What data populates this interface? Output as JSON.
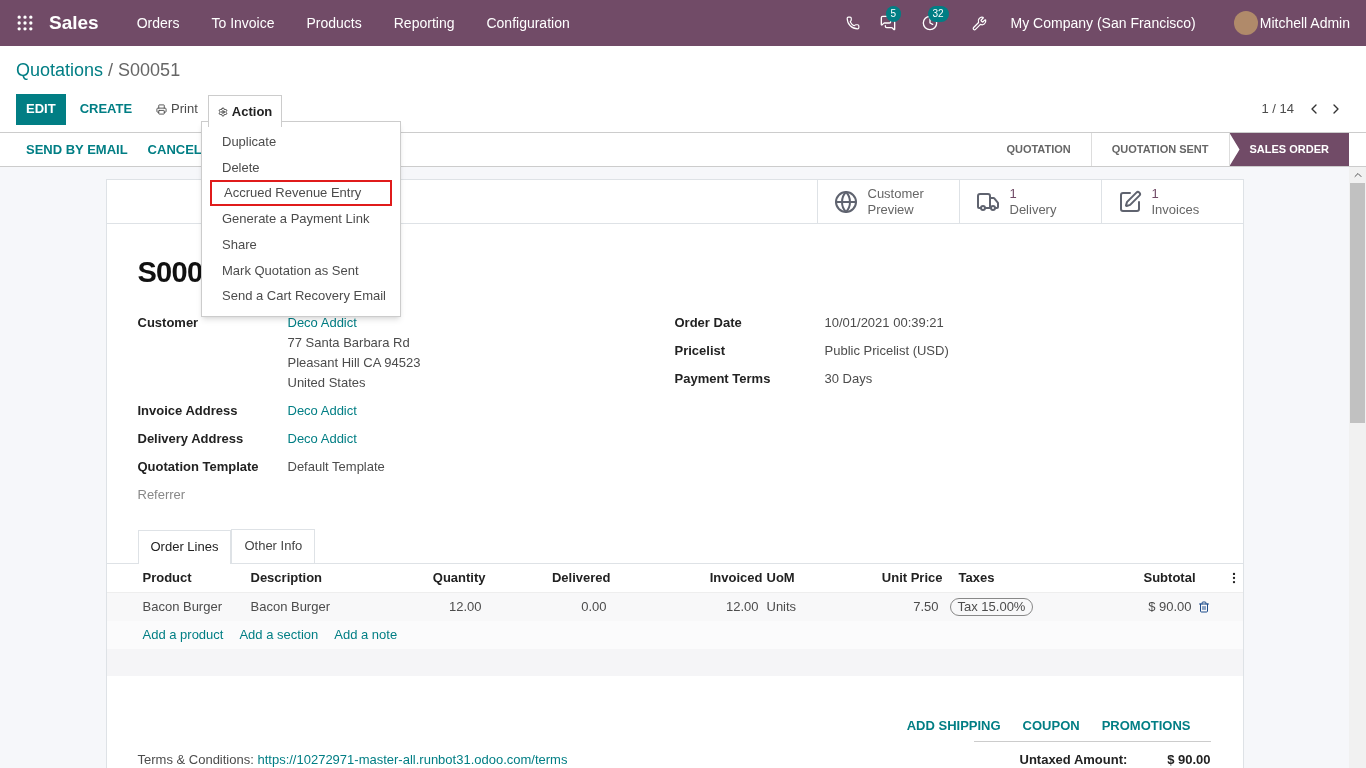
{
  "navbar": {
    "app_name": "Sales",
    "menu": [
      "Orders",
      "To Invoice",
      "Products",
      "Reporting",
      "Configuration"
    ],
    "chat_badge": "5",
    "activity_badge": "32",
    "company": "My Company (San Francisco)",
    "user": "Mitchell Admin"
  },
  "breadcrumb": {
    "parent": "Quotations",
    "separator": "/",
    "current": "S00051"
  },
  "toolbar": {
    "edit": "EDIT",
    "create": "CREATE",
    "print": "Print",
    "action": "Action",
    "pager": "1 / 14"
  },
  "action_menu": [
    {
      "label": "Duplicate",
      "highlighted": false
    },
    {
      "label": "Delete",
      "highlighted": false
    },
    {
      "label": "Accrued Revenue Entry",
      "highlighted": true
    },
    {
      "label": "Generate a Payment Link",
      "highlighted": false
    },
    {
      "label": "Share",
      "highlighted": false
    },
    {
      "label": "Mark Quotation as Sent",
      "highlighted": false
    },
    {
      "label": "Send a Cart Recovery Email",
      "highlighted": false
    }
  ],
  "status_buttons": [
    "SEND BY EMAIL",
    "CANCEL"
  ],
  "stages": [
    {
      "label": "QUOTATION",
      "selected": false
    },
    {
      "label": "QUOTATION SENT",
      "selected": false
    },
    {
      "label": "SALES ORDER",
      "selected": true
    }
  ],
  "smart_buttons": [
    {
      "kind": "globe",
      "lines": [
        "Customer",
        "Preview"
      ]
    },
    {
      "kind": "truck",
      "lines": [
        "1",
        "Delivery"
      ]
    },
    {
      "kind": "edit",
      "lines": [
        "1",
        "Invoices"
      ]
    }
  ],
  "title": "S000",
  "left_fields": [
    {
      "label": "Customer",
      "kind": "link",
      "values": [
        "Deco Addict",
        "77 Santa Barbara Rd",
        "Pleasant Hill CA 94523",
        "United States"
      ]
    },
    {
      "label": "Invoice Address",
      "kind": "link",
      "values": [
        "Deco Addict"
      ]
    },
    {
      "label": "Delivery Address",
      "kind": "link",
      "values": [
        "Deco Addict"
      ]
    },
    {
      "label": "Quotation Template",
      "kind": "text",
      "values": [
        "Default Template"
      ]
    },
    {
      "label": "Referrer",
      "kind": "empty"
    }
  ],
  "right_fields": [
    {
      "label": "Order Date",
      "value": "10/01/2021 00:39:21"
    },
    {
      "label": "Pricelist",
      "value": "Public Pricelist (USD)"
    },
    {
      "label": "Payment Terms",
      "value": "30 Days"
    }
  ],
  "tabs": [
    {
      "label": "Order Lines",
      "selected": true
    },
    {
      "label": "Other Info",
      "selected": false
    }
  ],
  "columns": [
    "Product",
    "Description",
    "Quantity",
    "Delivered",
    "Invoiced",
    "UoM",
    "Unit Price",
    "Taxes",
    "Subtotal"
  ],
  "rows": [
    {
      "product": "Bacon Burger",
      "description": "Bacon Burger",
      "quantity": "12.00",
      "delivered": "0.00",
      "invoiced": "12.00",
      "uom": "Units",
      "unit_price": "7.50",
      "taxes": "Tax 15.00%",
      "subtotal": "$ 90.00"
    }
  ],
  "add_links": [
    "Add a product",
    "Add a section",
    "Add a note"
  ],
  "footer_buttons": [
    "ADD SHIPPING",
    "COUPON",
    "PROMOTIONS"
  ],
  "terms": {
    "label": "Terms & Conditions:",
    "link": "https://10272971-master-all.runbot31.odoo.com/terms"
  },
  "totals": [
    {
      "label": "Untaxed Amount:",
      "value": "$ 90.00"
    }
  ]
}
